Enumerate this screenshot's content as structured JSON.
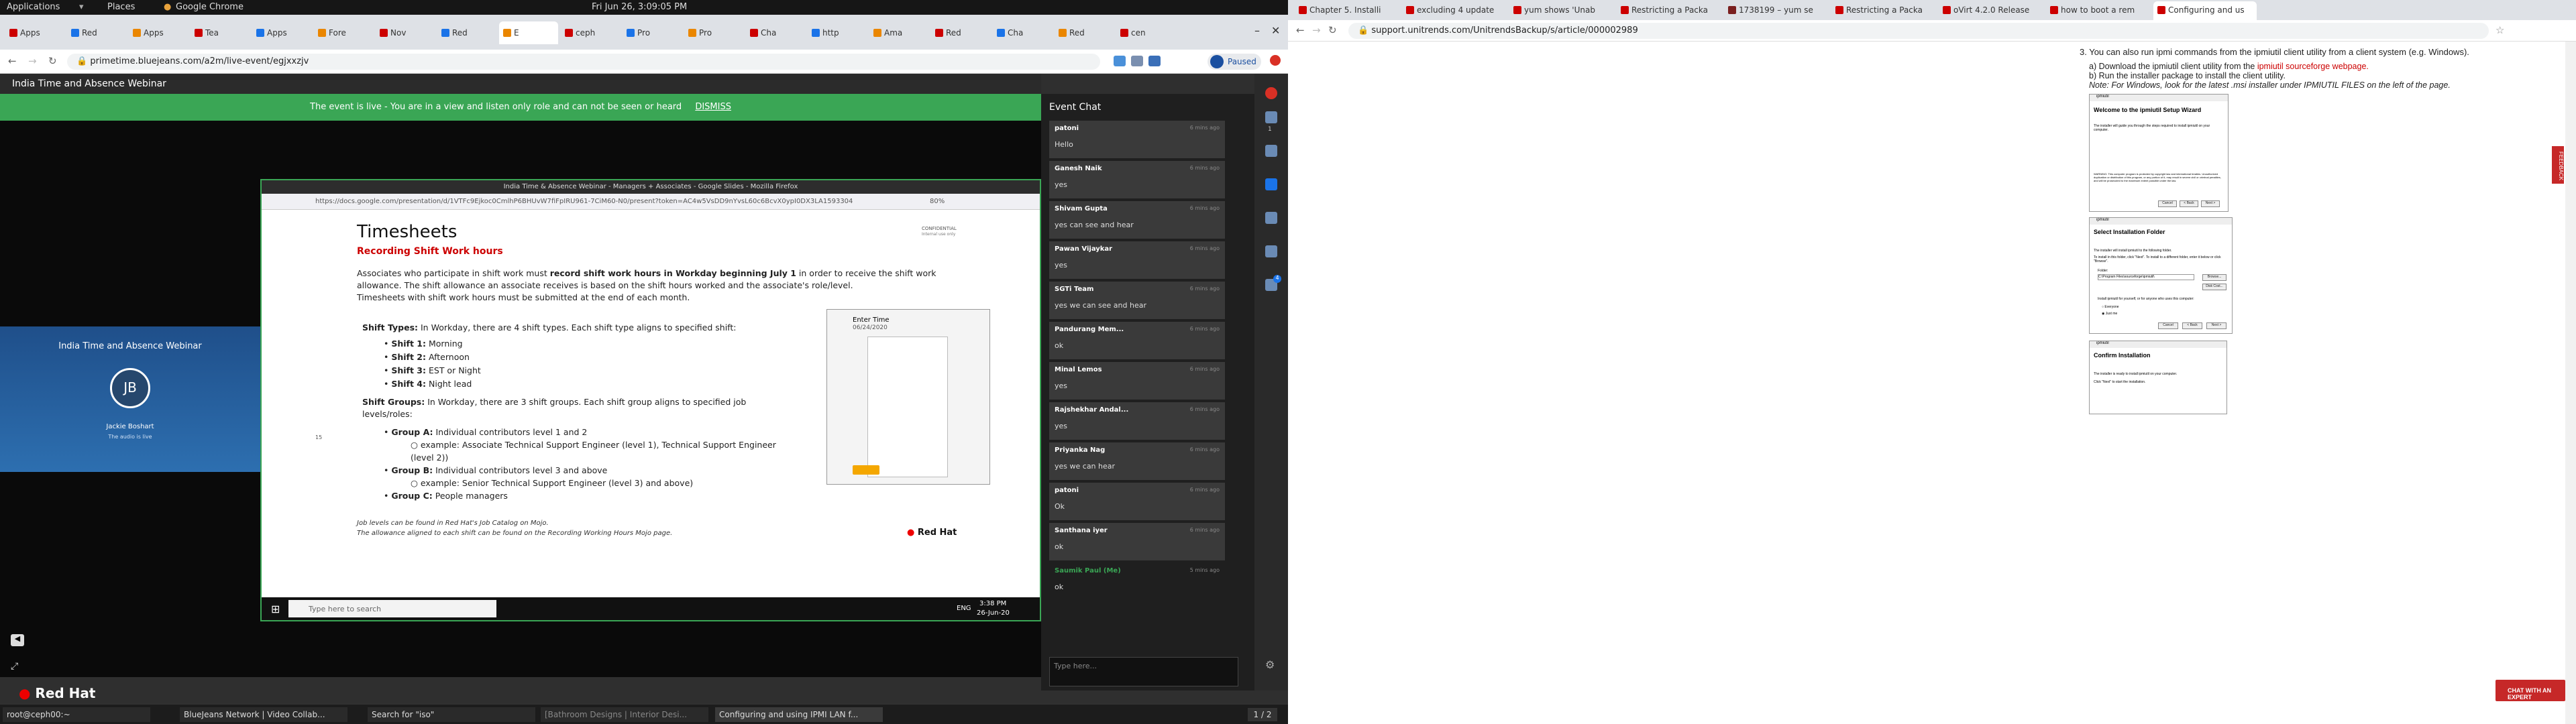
{
  "system_bar": {
    "applications": "Applications",
    "places": "Places",
    "app": "Google Chrome",
    "clock": "Fri Jun 26, 3:09:05 PM"
  },
  "left_browser": {
    "tabs": [
      "Apps",
      "Red",
      "Apps",
      "Tea",
      "Apps",
      "Fore",
      "Nov",
      "Red",
      "E",
      "ceph",
      "Pro",
      "Pro",
      "Cha",
      "http",
      "Ama",
      "Red",
      "Cha",
      "Red",
      "cen"
    ],
    "url": "primetime.bluejeans.com/a2m/live-event/egjxxzjv",
    "paused": "Paused",
    "webinar_title": "India Time and Absence Webinar",
    "banner_text": "The event is live - You are in a view and listen only role and can not be seen or heard",
    "dismiss": "DISMISS",
    "presenter": {
      "initials": "JB",
      "name": "Jackie Boshart",
      "card_title": "India Time and Absence Webinar",
      "line2": "The audio is live"
    },
    "inner_browser": {
      "title": "India Time & Absence Webinar - Managers + Associates - Google Slides - Mozilla Firefox",
      "url": "https://docs.google.com/presentation/d/1VTFc9Ejkoc0CmlhP6BHUvW7fiFpIRU961-7CiM60-N0/present?token=AC4w5VsDD9nYvsL60c6BcvX0ypI0DX3LA1593304",
      "zoom": "80%",
      "slide": {
        "heading": "Timesheets",
        "subheading": "Recording Shift Work hours",
        "confidential": "CONFIDENTIAL",
        "confidential2": "Internal use only",
        "intro_a": "Associates who participate in shift work must ",
        "intro_b": "record shift work hours in Workday beginning July 1",
        "intro_c": " in order to receive the shift work allowance. The shift allowance an associate receives is based on the shift hours worked and the associate's role/level.",
        "intro_d": "Timesheets with shift work hours must be submitted at the end of each month.",
        "shift_types_label": "Shift Types:",
        "shift_types_text": " In Workday, there are 4 shift types. Each shift type aligns to specified shift:",
        "shifts": [
          {
            "k": "Shift 1:",
            "v": " Morning"
          },
          {
            "k": "Shift 2:",
            "v": " Afternoon"
          },
          {
            "k": "Shift 3:",
            "v": " EST or Night"
          },
          {
            "k": "Shift 4:",
            "v": " Night lead"
          }
        ],
        "groups_label": "Shift Groups:",
        "groups_text": " In Workday, there are 3 shift groups. Each shift group aligns to specified job levels/roles:",
        "group_a": "Group A:",
        "group_a_text": " Individual contributors level 1 and 2",
        "group_a_ex": "example: Associate Technical Support Engineer (level 1), Technical Support Engineer (level 2))",
        "group_b": "Group B:",
        "group_b_text": " Individual contributors level 3 and above",
        "group_b_ex": "example: Senior Technical Support Engineer (level 3) and above)",
        "group_c": "Group C:",
        "group_c_text": " People managers",
        "footnote1": "Job levels can be found in Red Hat's Job Catalog on Mojo.",
        "footnote2": "The allowance aligned to each shift can be found on the Recording Working Hours Mojo page.",
        "logo": "Red Hat",
        "page_num": "15",
        "shot_title": "Enter Time",
        "shot_date": "06/24/2020"
      },
      "taskbar": {
        "search": "Type here to search",
        "lang": "ENG",
        "time": "3:38 PM",
        "date": "26-Jun-20"
      }
    },
    "chat": {
      "title": "Event Chat",
      "messages": [
        {
          "name": "patoni",
          "time": "6 mins ago",
          "text": "Hello"
        },
        {
          "name": "Ganesh Naik",
          "time": "6 mins ago",
          "text": "yes"
        },
        {
          "name": "Shivam Gupta",
          "time": "6 mins ago",
          "text": "yes can see and hear"
        },
        {
          "name": "Pawan Vijaykar",
          "time": "6 mins ago",
          "text": "yes"
        },
        {
          "name": "SGTi Team",
          "time": "6 mins ago",
          "text": "yes we can see and hear"
        },
        {
          "name": "Pandurang Mem...",
          "time": "6 mins ago",
          "text": "ok"
        },
        {
          "name": "Minal Lemos",
          "time": "6 mins ago",
          "text": "yes"
        },
        {
          "name": "Rajshekhar Andal...",
          "time": "6 mins ago",
          "text": "yes"
        },
        {
          "name": "Priyanka Nag",
          "time": "6 mins ago",
          "text": "yes we can hear"
        },
        {
          "name": "patoni",
          "time": "6 mins ago",
          "text": "Ok"
        },
        {
          "name": "Santhana iyer",
          "time": "6 mins ago",
          "text": "ok"
        },
        {
          "name": "Saumik Paul (Me)",
          "time": "5 mins ago",
          "text": "ok"
        }
      ],
      "input_placeholder": "Type here...",
      "side_badge_1": "1",
      "side_badge_2": "4"
    },
    "redhat_logo": "Red Hat"
  },
  "right_browser": {
    "tabs": [
      "Chapter 5. Installi",
      "excluding 4 update",
      "yum shows 'Unab",
      "Restricting a Packa",
      "1738199 – yum se",
      "Restricting a Packa",
      "oVirt 4.2.0 Release",
      "how to boot a rem",
      "Configuring and us"
    ],
    "url": "support.unitrends.com/UnitrendsBackup/s/article/000002989",
    "step3": "3. You can also run ipmi commands from the ipmiutil client utility from a client system (e.g. Windows).",
    "step_a_pre": "a)  Download the ipmiutil client utility from the ",
    "step_a_link": "ipmiutil sourceforge webpage.",
    "step_b": "b)  Run the installer package to install the client utility.",
    "note": "Note:  For Windows, look for the latest .msi installer under IPMIUTIL FILES on the left of the page.",
    "wizard1": {
      "title": "ipmiutil",
      "heading": "Welcome to the ipmiutil Setup Wizard",
      "body": "The installer will guide you through the steps required to install ipmiutil on your computer.",
      "warning": "WARNING: This computer program is protected by copyright law and international treaties. Unauthorized duplication or distribution of this program, or any portion of it, may result in severe civil or criminal penalties, and will be prosecuted to the maximum extent possible under the law.",
      "cancel": "Cancel",
      "back": "< Back",
      "next": "Next >"
    },
    "wizard2": {
      "title": "ipmiutil",
      "heading": "Select Installation Folder",
      "line1": "The installer will install ipmiutil to the following folder.",
      "line2": "To install in this folder, click \"Next\". To install to a different folder, enter it below or click \"Browse\".",
      "folder_label": "Folder:",
      "folder_value": "C:\\Program Files\\sourceforge\\ipmiutil\\",
      "browse": "Browse...",
      "disk_cost": "Disk Cost...",
      "install_for": "Install ipmiutil for yourself, or for anyone who uses this computer:",
      "everyone": "Everyone",
      "just_me": "Just me",
      "cancel": "Cancel",
      "back": "< Back",
      "next": "Next >"
    },
    "wizard3": {
      "title": "ipmiutil",
      "heading": "Confirm Installation",
      "line1": "The installer is ready to install ipmiutil on your computer.",
      "line2": "Click \"Next\" to start the installation."
    },
    "feedback": "FEEDBACK",
    "chat_expert": "CHAT WITH AN EXPERT"
  },
  "bottom_bar": {
    "items": [
      "root@ceph00:~",
      "BlueJeans Network | Video Collab...",
      "Search for \"iso\"",
      "[Bathroom Designs | Interior Desi...",
      "Configuring and using IPMI LAN f..."
    ],
    "workspace": "1 / 2"
  }
}
